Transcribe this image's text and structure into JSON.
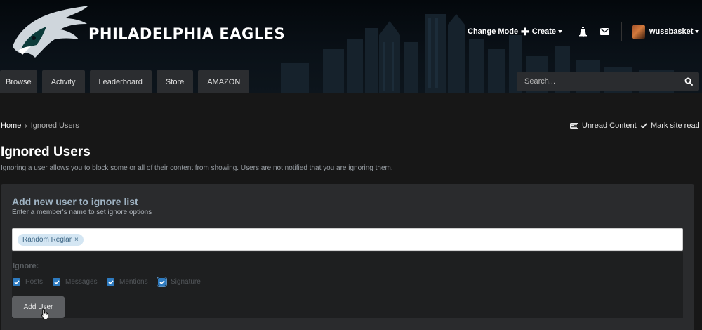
{
  "header": {
    "brand": "PHILADELPHIA EAGLES",
    "change_mode": "Change Mode",
    "create": "Create",
    "username": "wussbasket"
  },
  "nav": {
    "tabs": [
      "Browse",
      "Activity",
      "Leaderboard",
      "Store",
      "AMAZON"
    ]
  },
  "search": {
    "placeholder": "Search..."
  },
  "breadcrumb": {
    "home": "Home",
    "current": "Ignored Users"
  },
  "page_actions": {
    "unread": "Unread Content",
    "mark_read": "Mark site read"
  },
  "page": {
    "title": "Ignored Users",
    "description": "Ignoring a user allows you to block some or all of their content from showing. Users are not notified that you are ignoring them."
  },
  "panel": {
    "title": "Add new user to ignore list",
    "subtitle": "Enter a member's name to set ignore options",
    "token": "Random Reglar",
    "token_remove": "×",
    "ignore_label": "Ignore:",
    "options": [
      {
        "label": "Posts",
        "checked": true
      },
      {
        "label": "Messages",
        "checked": true
      },
      {
        "label": "Mentions",
        "checked": true
      },
      {
        "label": "Signature",
        "checked": true
      }
    ],
    "add_button": "Add User"
  },
  "colors": {
    "accent": "#2e7bc0",
    "panel_title": "#9fb3c3",
    "background": "#171717"
  }
}
